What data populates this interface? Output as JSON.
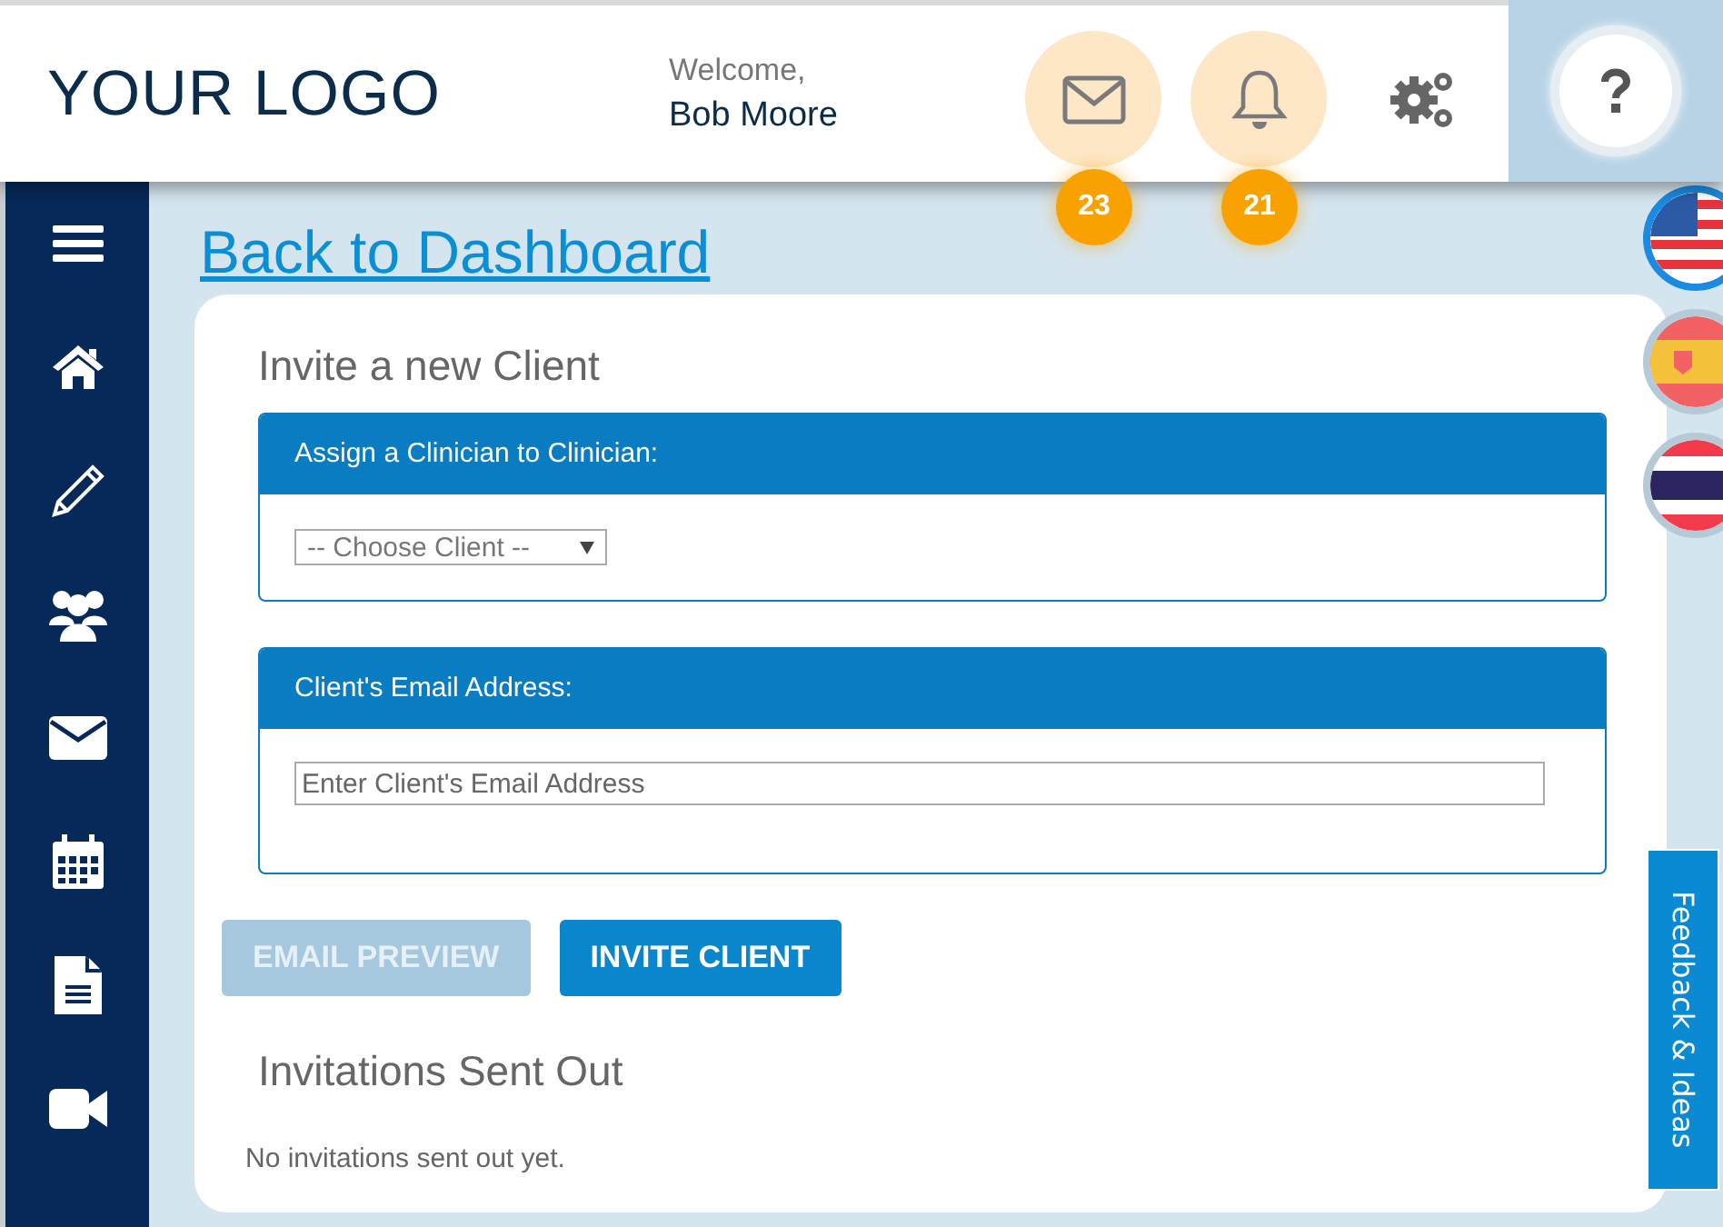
{
  "header": {
    "logo": "YOUR LOGO",
    "welcome": "Welcome,",
    "user": "Bob Moore",
    "notifications": [
      {
        "kind": "mail",
        "count": "23"
      },
      {
        "kind": "bell",
        "count": "21"
      }
    ]
  },
  "sidebar": {
    "items": [
      {
        "kind": "menu"
      },
      {
        "kind": "home"
      },
      {
        "kind": "pencil"
      },
      {
        "kind": "users"
      },
      {
        "kind": "mail"
      },
      {
        "kind": "calendar"
      },
      {
        "kind": "document"
      },
      {
        "kind": "video"
      }
    ]
  },
  "back_link": "Back to Dashboard",
  "card": {
    "title": "Invite a new Client",
    "panels": [
      {
        "kind": "select",
        "heading": "Assign a Clinician to Clinician:",
        "value": "-- Choose Client --"
      },
      {
        "kind": "input",
        "heading": "Client's Email Address:",
        "placeholder": "Enter Client's Email Address"
      }
    ],
    "buttons": [
      {
        "label": "EMAIL PREVIEW",
        "disabled": true
      },
      {
        "label": "INVITE CLIENT",
        "disabled": false
      }
    ],
    "invitations_title": "Invitations Sent Out",
    "empty_text": "No invitations sent out yet."
  },
  "languages": [
    {
      "kind": "us",
      "selected": true
    },
    {
      "kind": "es",
      "selected": false
    },
    {
      "kind": "th",
      "selected": false
    }
  ],
  "feedback_tab": "Feedback & Ideas"
}
